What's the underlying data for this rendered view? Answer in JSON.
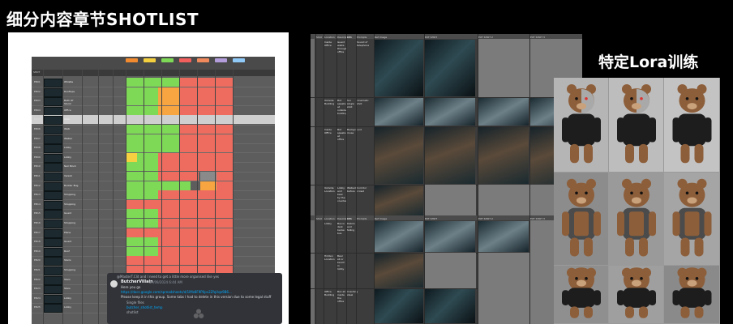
{
  "titles": {
    "left": "细分内容章节SHOTLIST",
    "right": "特定Lora训练"
  },
  "left_sheet": {
    "header_cells": [
      "SHOT",
      "",
      "",
      "",
      "",
      "",
      "",
      "",
      "",
      "",
      "",
      ""
    ],
    "chip_colors": [
      "#f28b30",
      "#f4d03f",
      "#7ed957",
      "#f25f5c",
      "#f08a5d",
      "#b39ddb",
      "#90caf9"
    ],
    "rows": [
      {
        "id": "EB01"
      },
      {
        "id": "EB02"
      },
      {
        "id": "EB03"
      },
      {
        "id": "EB04"
      },
      {
        "id": "EB05"
      },
      {
        "id": "EB06"
      },
      {
        "id": "EB07"
      },
      {
        "id": "EB08"
      },
      {
        "id": "EB09"
      },
      {
        "id": "EB10"
      },
      {
        "id": "EB11"
      },
      {
        "id": "EB12"
      },
      {
        "id": "EB13"
      },
      {
        "id": "EB14"
      },
      {
        "id": "EB15"
      },
      {
        "id": "EB16"
      },
      {
        "id": "EB17"
      },
      {
        "id": "EB18"
      },
      {
        "id": "EB19"
      },
      {
        "id": "EB20"
      },
      {
        "id": "EB21"
      },
      {
        "id": "EB22"
      },
      {
        "id": "EB23"
      },
      {
        "id": "EB24"
      },
      {
        "id": "EB25"
      }
    ],
    "labels": [
      "Whistle",
      "Rooftops",
      "Bath Of Storm",
      "Office",
      "Walk",
      "Walk",
      "Walker",
      "Lobby",
      "Lobby",
      "Nail Block",
      "Vanish",
      "Builder Bug",
      "Shopping",
      "Shopping",
      "Guard",
      "Shopping",
      "Plane",
      "Guard",
      "Roof",
      "Stairs",
      "Shopping",
      "Stars",
      "Stars",
      "Lobby",
      "Lobby"
    ]
  },
  "discord": {
    "reply": "@MasterT.Clit and I need to get a little more organised like yes",
    "username": "ButcherVillain",
    "timestamp": "07/09/2024 6:44 AM",
    "greeting": "Here you go",
    "link": "https://docs.google.com/spreadsheets/d/1lMz8F9P0pv2ZfqVqe9B6...",
    "message": "Please keep it in this group. Some tabs I had to delete in this version due to some legal stuff",
    "files": [
      "Single files",
      "butcher_shotlist_temp",
      "shotlist"
    ]
  },
  "mid_sheet": {
    "headers_top": [
      "Shot",
      "Location",
      "Description",
      "DTS",
      "Prompts",
      "Ref Image",
      "EXT SHOT",
      "EXT SHOT 2",
      "EXT SHOT 3"
    ],
    "headers_bottom": [
      "Shot",
      "Location",
      "Description",
      "DTS",
      "Prompts",
      "Ref Image",
      "EXT SHOT",
      "EXT SHOT 2",
      "EXT SHOT 3"
    ],
    "rows_top": [
      {
        "loc": "Inside Office",
        "desc": "Guard walks through office",
        "dts": "",
        "prompt": "Sound of telephone"
      },
      {
        "loc": "Outside Building",
        "desc": "Bot speaks at outside building",
        "dts": "Sur single shot",
        "prompt": "cinematic shot"
      },
      {
        "loc": "Inside Office",
        "desc": "Bot speaks at office",
        "dts": "Background muse",
        "prompt": ""
      },
      {
        "loc": "Outside Location",
        "desc": "Lobby and bear by the counter",
        "dts": "Walked before",
        "prompt": "Corridor crowd"
      }
    ],
    "rows_bottom": [
      {
        "loc": "Lobby",
        "desc": "Bus is dark below bus",
        "dts": "Debris and falling",
        "prompt": ""
      },
      {
        "loc": "Hidden Location",
        "desc": "Bear sit or bench in lobby",
        "dts": "",
        "prompt": ""
      },
      {
        "loc": "Office Building",
        "desc": "Box all inside the office",
        "dts": "Crashing steel",
        "prompt": ""
      }
    ]
  }
}
